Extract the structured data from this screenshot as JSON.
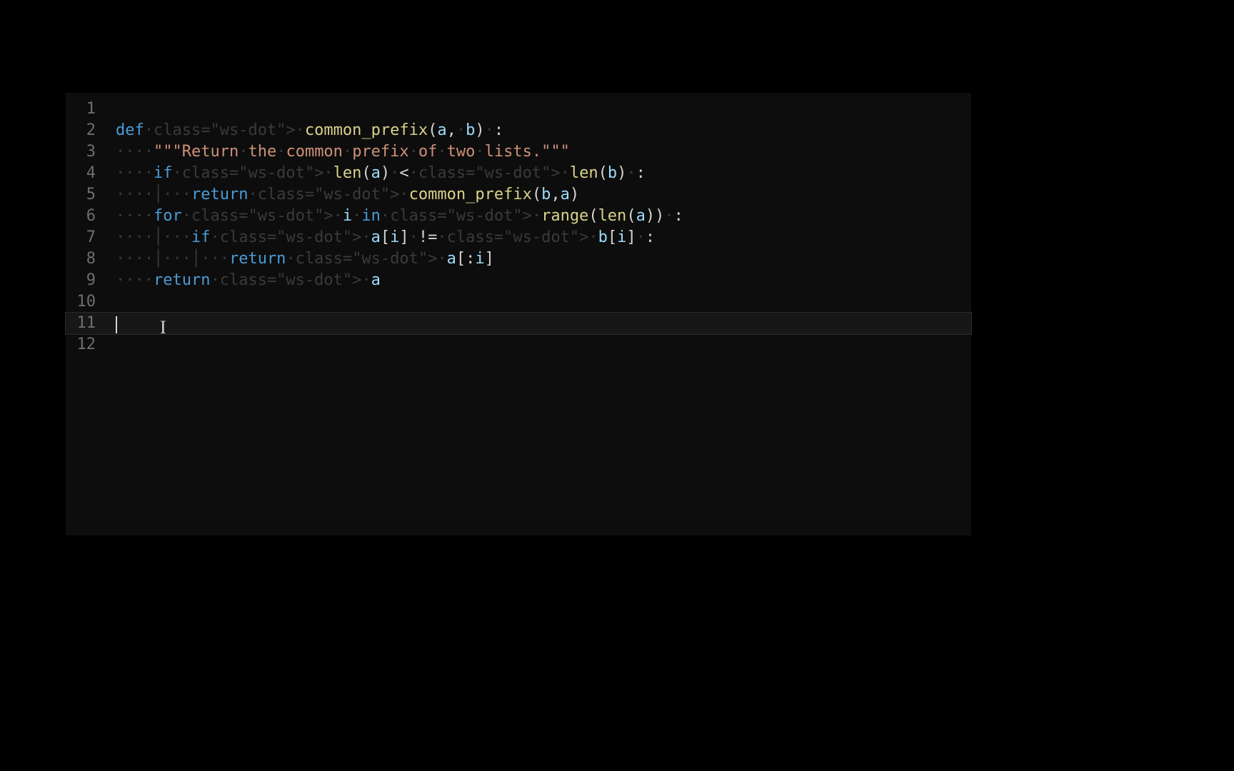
{
  "editor": {
    "cursor_line": 11,
    "lines": [
      {
        "num": "1",
        "indent": 0,
        "tokens": []
      },
      {
        "num": "2",
        "indent": 0,
        "tokens": [
          {
            "t": "def ",
            "c": "kw"
          },
          {
            "t": "common_prefix",
            "c": "fn"
          },
          {
            "t": "(",
            "c": "punc"
          },
          {
            "t": "a",
            "c": "param"
          },
          {
            "t": ", ",
            "c": "punc"
          },
          {
            "t": "b",
            "c": "param"
          },
          {
            "t": ") ",
            "c": "punc"
          },
          {
            "t": ":",
            "c": "colon"
          }
        ]
      },
      {
        "num": "3",
        "indent": 1,
        "tokens": [
          {
            "t": "\"\"\"Return the common prefix of two lists.\"\"\"",
            "c": "str"
          }
        ]
      },
      {
        "num": "4",
        "indent": 1,
        "tokens": [
          {
            "t": "if ",
            "c": "kw"
          },
          {
            "t": "len",
            "c": "builtin"
          },
          {
            "t": "(",
            "c": "punc"
          },
          {
            "t": "a",
            "c": "param"
          },
          {
            "t": ") ",
            "c": "punc"
          },
          {
            "t": "< ",
            "c": "op"
          },
          {
            "t": "len",
            "c": "builtin"
          },
          {
            "t": "(",
            "c": "punc"
          },
          {
            "t": "b",
            "c": "param"
          },
          {
            "t": ") ",
            "c": "punc"
          },
          {
            "t": ":",
            "c": "colon"
          }
        ]
      },
      {
        "num": "5",
        "indent": 2,
        "tokens": [
          {
            "t": "return ",
            "c": "kw"
          },
          {
            "t": "common_prefix",
            "c": "fn"
          },
          {
            "t": "(",
            "c": "punc"
          },
          {
            "t": "b",
            "c": "param"
          },
          {
            "t": ",",
            "c": "punc"
          },
          {
            "t": "a",
            "c": "param"
          },
          {
            "t": ")",
            "c": "punc"
          }
        ]
      },
      {
        "num": "6",
        "indent": 1,
        "tokens": [
          {
            "t": "for ",
            "c": "kw"
          },
          {
            "t": "i",
            "c": "param"
          },
          {
            "t": " ",
            "c": "punc"
          },
          {
            "t": "in ",
            "c": "kw"
          },
          {
            "t": "range",
            "c": "builtin"
          },
          {
            "t": "(",
            "c": "punc"
          },
          {
            "t": "len",
            "c": "builtin"
          },
          {
            "t": "(",
            "c": "punc"
          },
          {
            "t": "a",
            "c": "param"
          },
          {
            "t": ")) ",
            "c": "punc"
          },
          {
            "t": ":",
            "c": "colon"
          }
        ]
      },
      {
        "num": "7",
        "indent": 2,
        "tokens": [
          {
            "t": "if ",
            "c": "kw"
          },
          {
            "t": "a",
            "c": "param"
          },
          {
            "t": "[",
            "c": "punc"
          },
          {
            "t": "i",
            "c": "param"
          },
          {
            "t": "] ",
            "c": "punc"
          },
          {
            "t": "!= ",
            "c": "op"
          },
          {
            "t": "b",
            "c": "param"
          },
          {
            "t": "[",
            "c": "punc"
          },
          {
            "t": "i",
            "c": "param"
          },
          {
            "t": "] ",
            "c": "punc"
          },
          {
            "t": ":",
            "c": "colon"
          }
        ]
      },
      {
        "num": "8",
        "indent": 3,
        "tokens": [
          {
            "t": "return ",
            "c": "kw"
          },
          {
            "t": "a",
            "c": "param"
          },
          {
            "t": "[:",
            "c": "punc"
          },
          {
            "t": "i",
            "c": "param"
          },
          {
            "t": "]",
            "c": "punc"
          }
        ]
      },
      {
        "num": "9",
        "indent": 1,
        "tokens": [
          {
            "t": "return ",
            "c": "kw"
          },
          {
            "t": "a",
            "c": "param"
          }
        ]
      },
      {
        "num": "10",
        "indent": 0,
        "tokens": []
      },
      {
        "num": "11",
        "indent": 0,
        "tokens": []
      },
      {
        "num": "12",
        "indent": 0,
        "tokens": []
      }
    ],
    "whitespace_glyph": "·",
    "indent_guide_glyph": "│"
  },
  "colors": {
    "background": "#000000",
    "editor_bg": "#0d0d0d",
    "gutter_fg": "#6e6e6e",
    "keyword": "#4a9cd6",
    "function": "#d9d28a",
    "param": "#9cdcfe",
    "string": "#ce9178",
    "default": "#d4d4d4",
    "whitespace": "#3a3a3a"
  }
}
